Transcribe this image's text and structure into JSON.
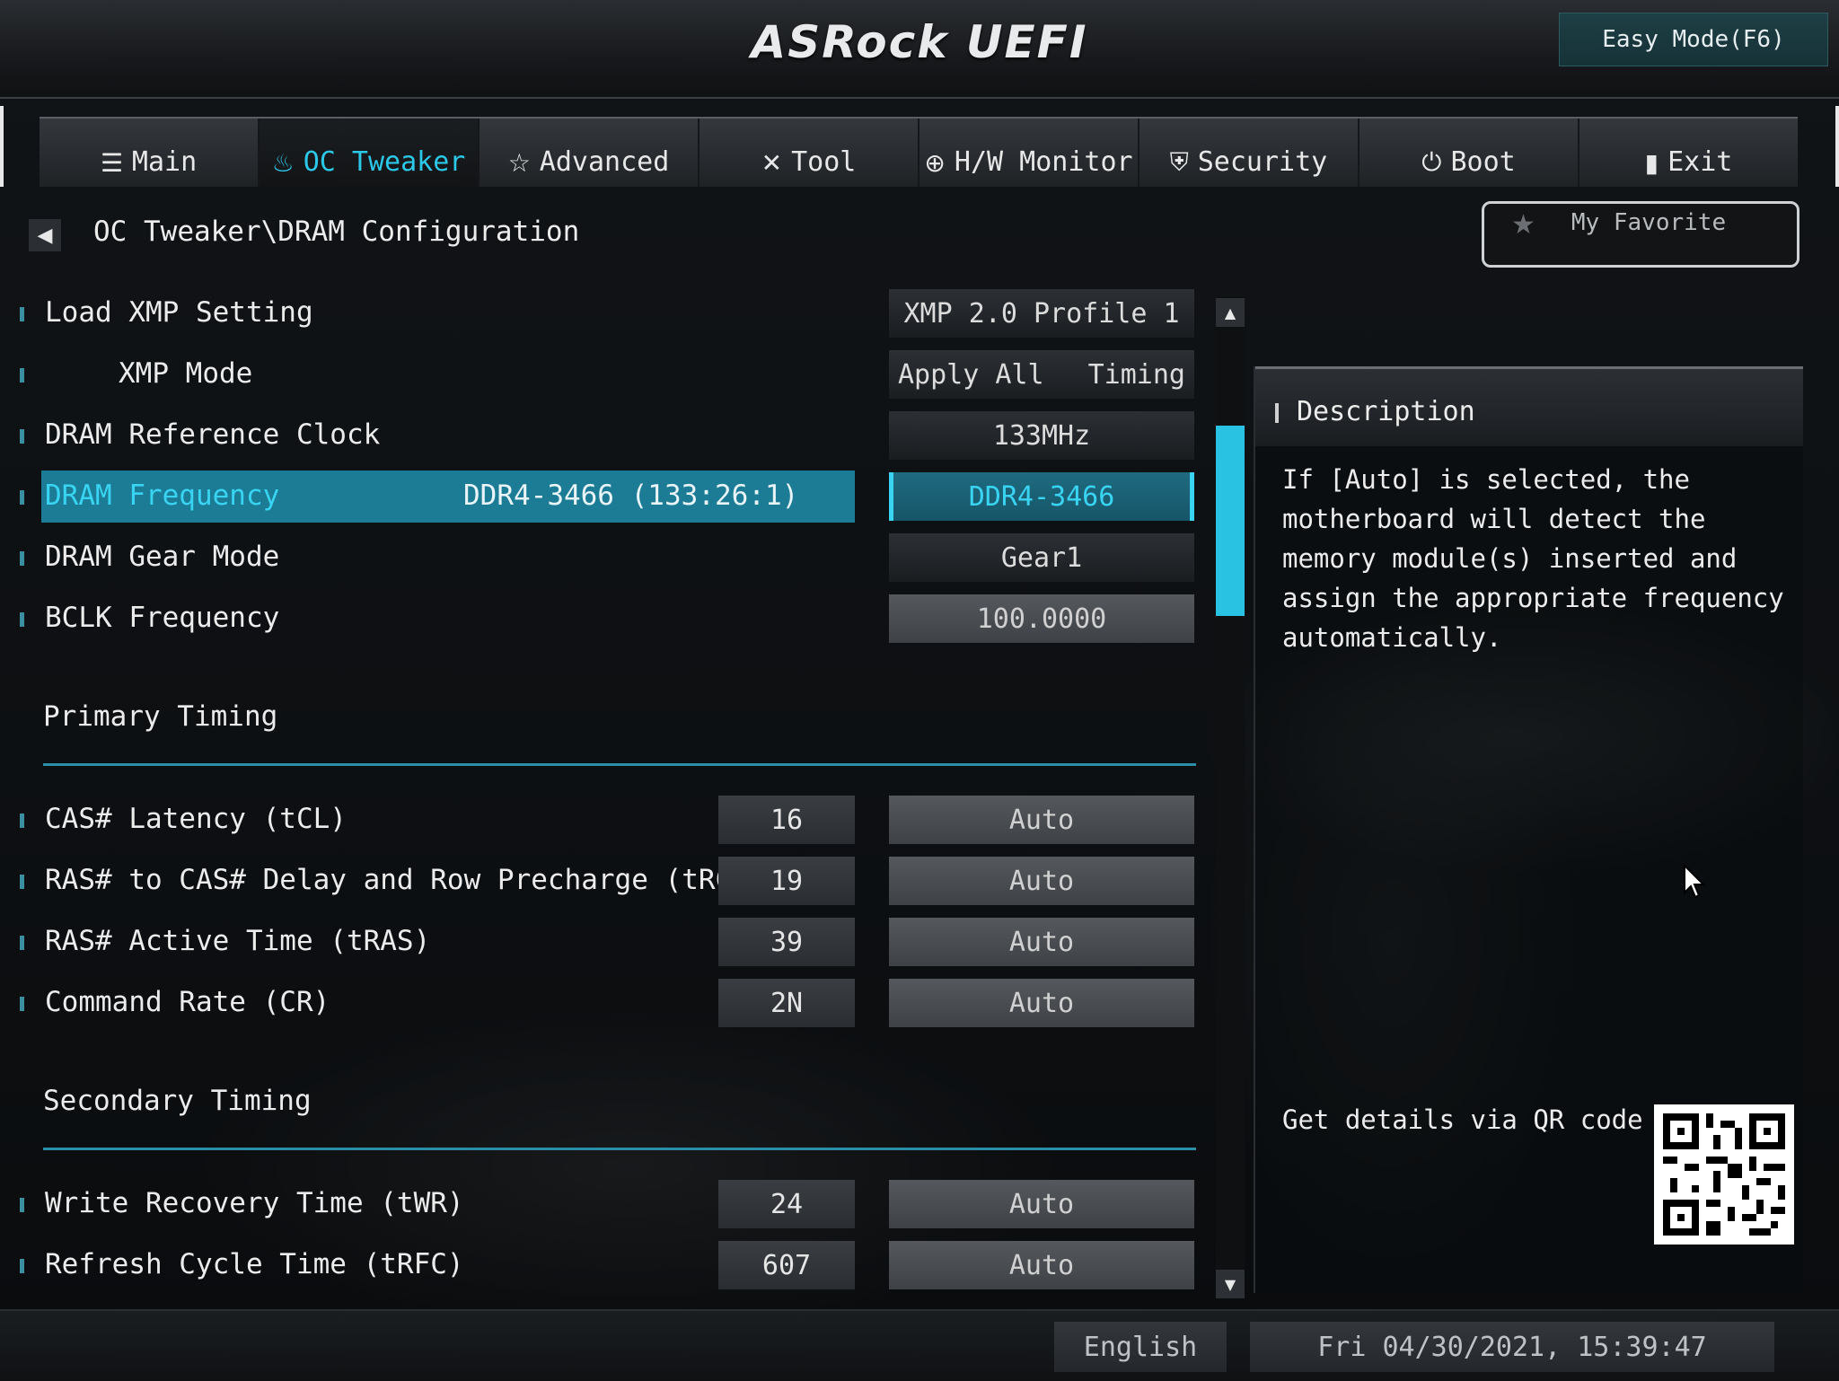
{
  "header": {
    "logo": "ASRock UEFI",
    "easy_mode": "Easy Mode(F6)"
  },
  "tabs": [
    {
      "label": "Main",
      "icon": "list-icon"
    },
    {
      "label": "OC Tweaker",
      "icon": "flame-icon"
    },
    {
      "label": "Advanced",
      "icon": "star-icon"
    },
    {
      "label": "Tool",
      "icon": "tools-icon"
    },
    {
      "label": "H/W Monitor",
      "icon": "monitor-gauge-icon"
    },
    {
      "label": "Security",
      "icon": "shield-icon"
    },
    {
      "label": "Boot",
      "icon": "power-icon"
    },
    {
      "label": "Exit",
      "icon": "exit-door-icon"
    }
  ],
  "active_tab": "OC Tweaker",
  "breadcrumb": "OC Tweaker\\DRAM Configuration",
  "favorite": "My Favorite",
  "settings": {
    "load_xmp": {
      "label": "Load XMP Setting",
      "value": "XMP 2.0 Profile 1"
    },
    "xmp_mode": {
      "label": "XMP Mode",
      "value_left": "Apply All",
      "value_right": "Timing"
    },
    "dram_ref_clock": {
      "label": "DRAM Reference Clock",
      "value": "133MHz"
    },
    "dram_freq": {
      "label": "DRAM Frequency",
      "info": "DDR4-3466 (133:26:1)",
      "value": "DDR4-3466"
    },
    "gear_mode": {
      "label": "DRAM Gear Mode",
      "value": "Gear1"
    },
    "bclk": {
      "label": "BCLK Frequency",
      "value": "100.0000"
    }
  },
  "primary": {
    "title": "Primary Timing",
    "rows": [
      {
        "label": "CAS# Latency (tCL)",
        "current": "16",
        "value": "Auto"
      },
      {
        "label": "RAS# to CAS# Delay and Row Precharge (tRCDtRP)",
        "current": "19",
        "value": "Auto"
      },
      {
        "label": "RAS# Active Time (tRAS)",
        "current": "39",
        "value": "Auto"
      },
      {
        "label": "Command Rate (CR)",
        "current": "2N",
        "value": "Auto"
      }
    ]
  },
  "secondary": {
    "title": "Secondary Timing",
    "rows": [
      {
        "label": "Write Recovery Time (tWR)",
        "current": "24",
        "value": "Auto"
      },
      {
        "label": "Refresh Cycle Time (tRFC)",
        "current": "607",
        "value": "Auto"
      }
    ]
  },
  "description": {
    "title": "Description",
    "text": "If [Auto] is selected, the motherboard will detect the memory module(s) inserted and assign the appropriate frequency automatically.",
    "qr_label": "Get details via QR code"
  },
  "footer": {
    "language": "English",
    "datetime": "Fri 04/30/2021, 15:39:47"
  },
  "colors": {
    "accent": "#29c2e2",
    "highlight_row": "#1c7c95"
  }
}
